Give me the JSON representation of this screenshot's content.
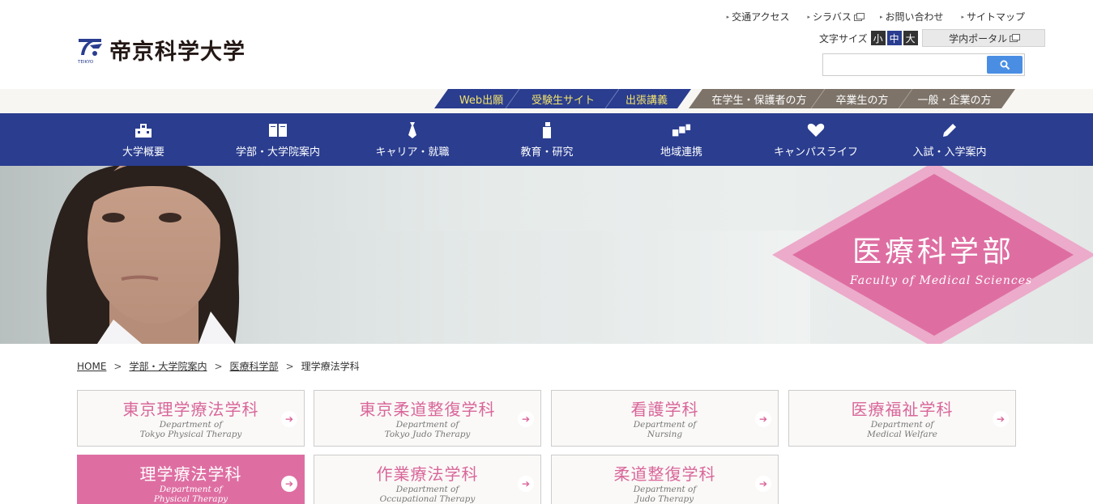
{
  "header": {
    "logo_text": "帝京科学大学",
    "logo_sub": "TEIKYO",
    "util_links": [
      "交通アクセス",
      "シラバス",
      "お問い合わせ",
      "サイトマップ"
    ],
    "font_size_label": "文字サイズ",
    "font_sizes": [
      "小",
      "中",
      "大"
    ],
    "portal_label": "学内ポータル",
    "search_placeholder": ""
  },
  "subnav": {
    "blue_items": [
      "Web出願",
      "受験生サイト",
      "出張講義"
    ],
    "gray_items": [
      "在学生・保護者の方",
      "卒業生の方",
      "一般・企業の方"
    ]
  },
  "mainnav": {
    "items": [
      "大学概要",
      "学部・大学院案内",
      "キャリア・就職",
      "教育・研究",
      "地域連携",
      "キャンパスライフ",
      "入試・入学案内"
    ]
  },
  "hero": {
    "title": "医療科学部",
    "subtitle": "Faculty of Medical Sciences"
  },
  "breadcrumb": {
    "items": [
      "HOME",
      "学部・大学院案内",
      "医療科学部",
      "理学療法学科"
    ]
  },
  "departments": [
    {
      "title": "東京理学療法学科",
      "en1": "Department of",
      "en2": "Tokyo Physical Therapy"
    },
    {
      "title": "東京柔道整復学科",
      "en1": "Department of",
      "en2": "Tokyo Judo Therapy"
    },
    {
      "title": "看護学科",
      "en1": "Department of",
      "en2": "Nursing"
    },
    {
      "title": "医療福祉学科",
      "en1": "Department of",
      "en2": "Medical Welfare"
    },
    {
      "title": "理学療法学科",
      "en1": "Department of",
      "en2": "Physical Therapy"
    },
    {
      "title": "作業療法学科",
      "en1": "Department of",
      "en2": "Occupational Therapy"
    },
    {
      "title": "柔道整復学科",
      "en1": "Department of",
      "en2": "Judo Therapy"
    }
  ],
  "colors": {
    "primary_blue": "#2a3d8f",
    "accent_pink": "#de6ea2",
    "subnav_gray": "#7d7369",
    "subnav_text_yellow": "#f3e36b",
    "search_blue": "#4a8ee4"
  }
}
